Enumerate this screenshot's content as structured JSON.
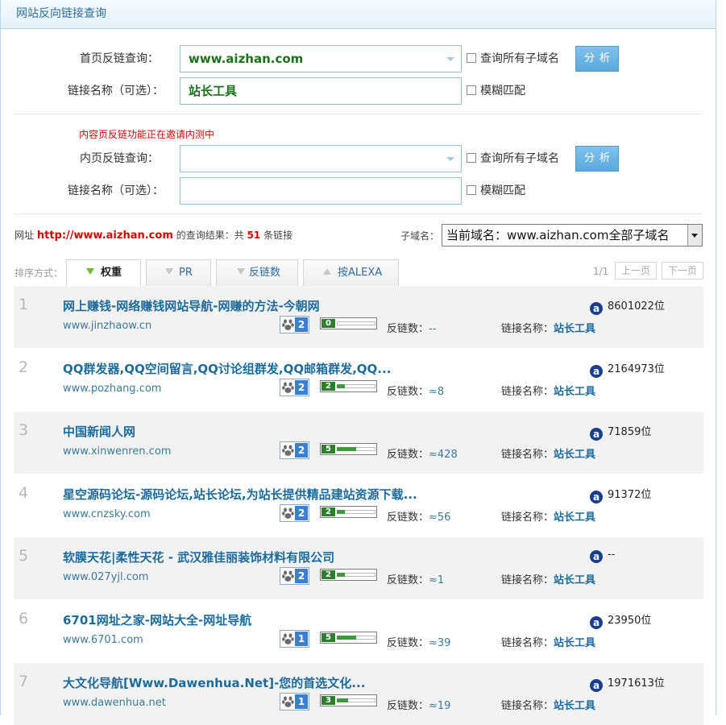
{
  "panel_title": "网站反向链接查询",
  "homepage_query": {
    "label": "首页反链查询：",
    "value": "www.aizhan.com",
    "subdomain_label": "查询所有子域名",
    "analyze_label": "分析",
    "anchor_label": "链接名称（可选）：",
    "anchor_value": "站长工具",
    "fuzzy_label": "模糊匹配"
  },
  "inner_query": {
    "notice": "内容页反链功能正在邀请内测中",
    "label": "内页反链查询：",
    "value": "",
    "subdomain_label": "查询所有子域名",
    "analyze_label": "分析",
    "anchor_label": "链接名称（可选）：",
    "anchor_value": "",
    "fuzzy_label": "模糊匹配"
  },
  "summary": {
    "prefix": "网址",
    "url": "http://www.aizhan.com",
    "middle": "的查询结果：共",
    "count": "51",
    "suffix": "条链接",
    "subdomain_label": "子域名：",
    "subdomain_selected": "当前域名：www.aizhan.com全部子域名"
  },
  "sort": {
    "label": "排序方式：",
    "tabs": [
      "权重",
      "PR",
      "反链数",
      "按ALEXA"
    ],
    "active": "权重"
  },
  "pagination": {
    "page": "1/1",
    "prev": "上一页",
    "next": "下一页"
  },
  "colors": {
    "accent": "#1d6b9a",
    "red": "#d40000",
    "pr_green": "#2f7d2f",
    "baidu_blue": "#3b7fd0"
  },
  "icons": {
    "baidu": "paw-icon",
    "alexa": "alexa-icon",
    "sort_down": "arrow-down-icon",
    "sort_up": "arrow-up-icon"
  },
  "labels": {
    "backlinks": "反链数：",
    "anchor": "链接名称：",
    "rank_suffix": "位"
  },
  "results": [
    {
      "num": "1",
      "title": "网上赚钱-网络赚钱网站导航-网赚的方法-今朝网",
      "domain": "www.jinzhaow.cn",
      "br": "2",
      "pr": "0",
      "pr_fill": 0,
      "backlinks": "--",
      "anchor": "站长工具",
      "alexa": "8601022位"
    },
    {
      "num": "2",
      "title": "QQ群发器,QQ空间留言,QQ讨论组群发,QQ邮箱群发,QQ...",
      "domain": "www.pozhang.com",
      "br": "2",
      "pr": "2",
      "pr_fill": 0.2,
      "backlinks": "≈8",
      "anchor": "站长工具",
      "alexa": "2164973位"
    },
    {
      "num": "3",
      "title": "中国新闻人网",
      "domain": "www.xinwenren.com",
      "br": "2",
      "pr": "5",
      "pr_fill": 0.5,
      "backlinks": "≈428",
      "anchor": "站长工具",
      "alexa": "71859位"
    },
    {
      "num": "4",
      "title": "星空源码论坛-源码论坛,站长论坛,为站长提供精品建站资源下载...",
      "domain": "www.cnzsky.com",
      "br": "2",
      "pr": "2",
      "pr_fill": 0.2,
      "backlinks": "≈56",
      "anchor": "站长工具",
      "alexa": "91372位"
    },
    {
      "num": "5",
      "title": "软膜天花|柔性天花 - 武汉雅佳丽装饰材料有限公司",
      "domain": "www.027yjl.com",
      "br": "2",
      "pr": "2",
      "pr_fill": 0.2,
      "backlinks": "≈1",
      "anchor": "站长工具",
      "alexa": "--"
    },
    {
      "num": "6",
      "title": "6701网址之家-网站大全-网址导航",
      "domain": "www.6701.com",
      "br": "1",
      "pr": "5",
      "pr_fill": 0.5,
      "backlinks": "≈39",
      "anchor": "站长工具",
      "alexa": "23950位"
    },
    {
      "num": "7",
      "title": "大文化导航[Www.Dawenhua.Net]-您的首选文化...",
      "domain": "www.dawenhua.net",
      "br": "1",
      "pr": "3",
      "pr_fill": 0.3,
      "backlinks": "≈19",
      "anchor": "站长工具",
      "alexa": "1971613位"
    }
  ]
}
